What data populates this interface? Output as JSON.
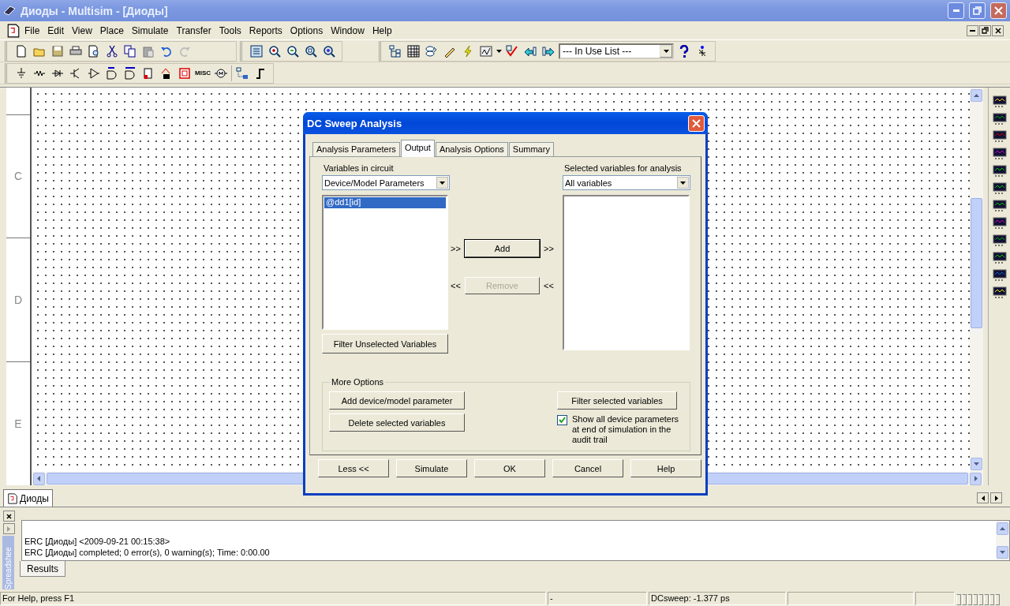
{
  "window": {
    "title": "Диоды - Multisim - [Диоды]"
  },
  "menu": [
    "File",
    "Edit",
    "View",
    "Place",
    "Simulate",
    "Transfer",
    "Tools",
    "Reports",
    "Options",
    "Window",
    "Help"
  ],
  "toolbar": {
    "combo": "--- In Use List ---",
    "misc_label": "MISC"
  },
  "sheet_labels": [
    "C",
    "D",
    "E"
  ],
  "dialog": {
    "title": "DC Sweep Analysis",
    "tabs": [
      {
        "label": "Analysis Parameters",
        "selected": false
      },
      {
        "label": "Output",
        "selected": true
      },
      {
        "label": "Analysis Options",
        "selected": false
      },
      {
        "label": "Summary",
        "selected": false
      }
    ],
    "left": {
      "label": "Variables in circuit",
      "dropdown": "Device/Model Parameters",
      "items": [
        {
          "text": "@dd1[id]",
          "selected": true
        }
      ],
      "button": "Filter Unselected Variables"
    },
    "right": {
      "label": "Selected variables for analysis",
      "dropdown": "All variables"
    },
    "transfer": [
      {
        "label": "Add",
        "before": ">>",
        "after": ">>",
        "disabled": false
      },
      {
        "label": "Remove",
        "before": "<<",
        "after": "<<",
        "disabled": true
      }
    ],
    "more_options": {
      "title": "More Options",
      "left_buttons": [
        "Add device/model parameter",
        "Delete selected variables"
      ],
      "right_button": "Filter selected variables",
      "checkbox": {
        "label": "Show all device parameters at end of simulation in the audit trail",
        "checked": true
      }
    },
    "footer": [
      "Less <<",
      "Simulate",
      "OK",
      "Cancel",
      "Help"
    ]
  },
  "sheet_tab": "Диоды",
  "spreadsheet": {
    "side_label": "Spreadshee",
    "lines": [
      "ERC [Диоды]  <2009-09-21 00:15:38>",
      "ERC [Диоды] completed;  0 error(s), 0 warning(s);  Time: 0:00.00"
    ],
    "tab": "Results"
  },
  "status_bar": [
    "For Help, press F1",
    "-",
    "DCsweep: -1.377 ps"
  ]
}
